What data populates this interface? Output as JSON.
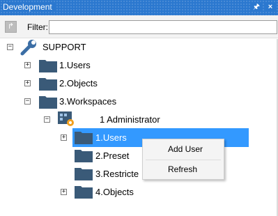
{
  "window": {
    "title": "Development",
    "pin_glyph": "⨇",
    "close_glyph": "×"
  },
  "toolbar": {
    "nav_icon": "arrow-icon",
    "filter_label": "Filter:",
    "filter_value": ""
  },
  "tree": {
    "root": {
      "label": "SUPPORT",
      "icon": "wrench-icon"
    },
    "users": "1.Users",
    "objects": "2.Objects",
    "workspaces": "3.Workspaces",
    "admin": "1 Administrator",
    "ws_users": "1.Users",
    "ws_preset": "2.Preset",
    "ws_restricted": "3.Restricte",
    "ws_objects": "4.Objects"
  },
  "context_menu": {
    "items": [
      "Add User",
      "Refresh"
    ]
  },
  "colors": {
    "titlebar": "#2b78cf",
    "selection": "#3399ff",
    "folder": "#3a5a78"
  }
}
